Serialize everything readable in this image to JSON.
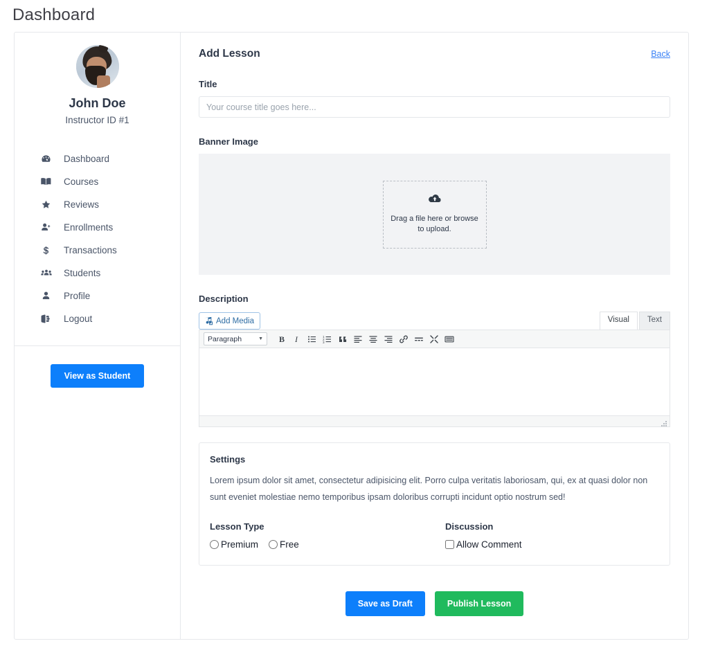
{
  "page": {
    "title": "Dashboard"
  },
  "sidebar": {
    "profile": {
      "name": "John Doe",
      "subtitle": "Instructor ID #1",
      "avatar_icon": "user-avatar-photo"
    },
    "items": [
      {
        "label": "Dashboard",
        "icon": "tachometer-icon"
      },
      {
        "label": "Courses",
        "icon": "book-open-icon"
      },
      {
        "label": "Reviews",
        "icon": "star-icon"
      },
      {
        "label": "Enrollments",
        "icon": "user-plus-icon"
      },
      {
        "label": "Transactions",
        "icon": "dollar-sign-icon"
      },
      {
        "label": "Students",
        "icon": "users-icon"
      },
      {
        "label": "Profile",
        "icon": "user-icon"
      },
      {
        "label": "Logout",
        "icon": "sign-out-icon"
      }
    ],
    "view_as_student_label": "View as Student"
  },
  "main": {
    "heading": "Add Lesson",
    "back_label": "Back",
    "title_field": {
      "label": "Title",
      "value": "",
      "placeholder": "Your course title goes here..."
    },
    "banner": {
      "label": "Banner Image",
      "dropzone_line1": "Drag a file here or browse",
      "dropzone_line2": "to upload.",
      "upload_icon": "cloud-upload-icon"
    },
    "description": {
      "label": "Description",
      "add_media_label": "Add Media",
      "add_media_icon": "media-icon",
      "tabs": [
        {
          "label": "Visual",
          "active": true
        },
        {
          "label": "Text",
          "active": false
        }
      ],
      "format_select": {
        "value": "Paragraph",
        "caret_icon": "chevron-down-icon"
      },
      "toolbar_buttons": [
        {
          "icon": "bold-icon",
          "label": "B"
        },
        {
          "icon": "italic-icon",
          "label": "I"
        },
        {
          "icon": "bullet-list-icon",
          "label": ""
        },
        {
          "icon": "numbered-list-icon",
          "label": ""
        },
        {
          "icon": "blockquote-icon",
          "label": ""
        },
        {
          "icon": "align-left-icon",
          "label": ""
        },
        {
          "icon": "align-center-icon",
          "label": ""
        },
        {
          "icon": "align-right-icon",
          "label": ""
        },
        {
          "icon": "link-icon",
          "label": ""
        },
        {
          "icon": "read-more-icon",
          "label": ""
        },
        {
          "icon": "fullscreen-icon",
          "label": ""
        },
        {
          "icon": "toolbar-toggle-icon",
          "label": ""
        }
      ],
      "content": "",
      "resize_icon": "resize-handle-icon"
    },
    "settings": {
      "title": "Settings",
      "description": "Lorem ipsum dolor sit amet, consectetur adipisicing elit. Porro culpa veritatis laboriosam, qui, ex at quasi dolor non sunt eveniet molestiae nemo temporibus ipsam doloribus corrupti incidunt optio nostrum sed!",
      "lesson_type": {
        "label": "Lesson Type",
        "options": [
          {
            "label": "Premium",
            "checked": false
          },
          {
            "label": "Free",
            "checked": false
          }
        ]
      },
      "discussion": {
        "label": "Discussion",
        "options": [
          {
            "label": "Allow Comment",
            "checked": false
          }
        ]
      }
    },
    "actions": {
      "save_draft_label": "Save as Draft",
      "publish_label": "Publish Lesson"
    }
  },
  "colors": {
    "primary_blue": "#0d7ffb",
    "publish_green": "#20ba5d",
    "link_blue": "#3b82f6",
    "banner_bg": "#f2f3f5"
  }
}
